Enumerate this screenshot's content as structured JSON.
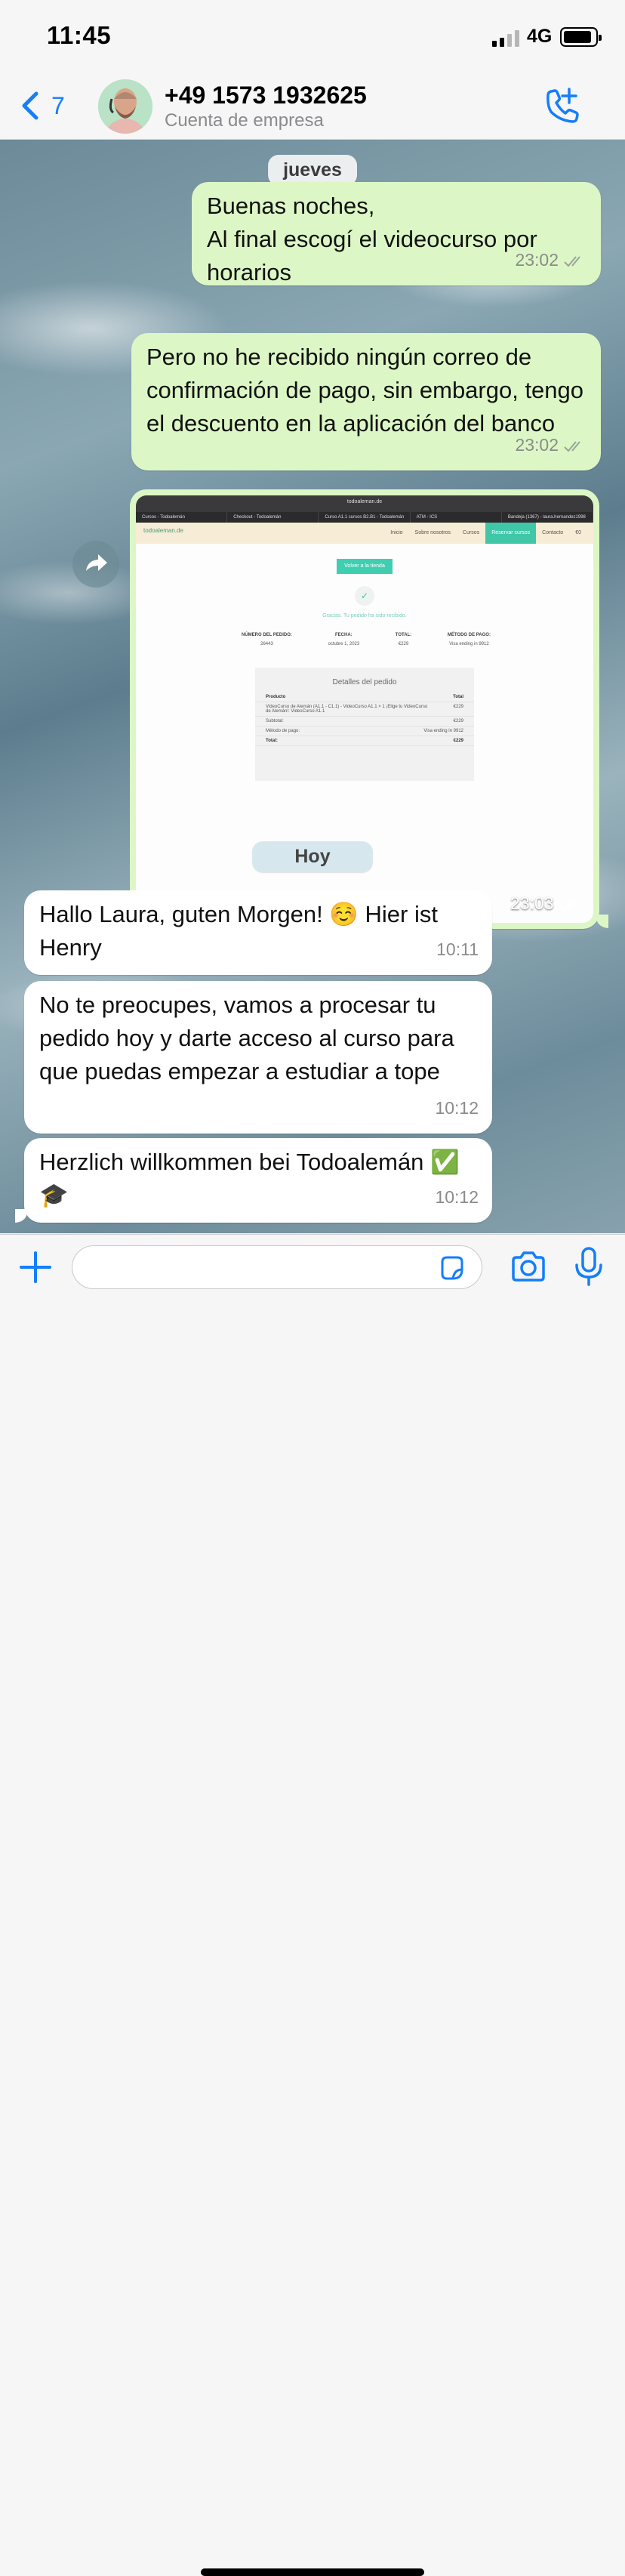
{
  "status_bar": {
    "time": "11:45",
    "network": "4G"
  },
  "header": {
    "back_count": "7",
    "contact_name": "+49 1573 1932625",
    "contact_subtitle": "Cuenta de empresa"
  },
  "chat": {
    "date_separators": {
      "first": "jueves",
      "second": "Hoy"
    },
    "messages": [
      {
        "direction": "out",
        "text": "Buenas noches,\nAl final escogí el videocurso por horarios",
        "time": "23:02",
        "status": "read"
      },
      {
        "direction": "out",
        "text": "Pero no he recibido ningún correo de confirmación de pago, sin embargo, tengo el descuento en la aplicación del banco",
        "time": "23:02",
        "status": "read"
      },
      {
        "direction": "out",
        "type": "image",
        "time": "23:03",
        "status": "read"
      },
      {
        "direction": "in",
        "text": "Hallo Laura, guten Morgen! ☺️ Hier ist Henry",
        "time": "10:11"
      },
      {
        "direction": "in",
        "text": "No te preocupes, vamos a procesar tu pedido hoy y darte acceso al curso para que puedas empezar a estudiar a tope",
        "time": "10:12"
      },
      {
        "direction": "in",
        "text": "Herzlich willkommen bei Todoalemán ✅🎓",
        "time": "10:12"
      }
    ]
  },
  "screenshot": {
    "url": "todoaleman.de",
    "tabs": [
      "Cursos - Todoalemán",
      "Checkout - Todoalemán",
      "Curso A1.1 cursos B2.B1 - Todoalemán",
      "ATM - ICS",
      "Bandeja (1367) - laura.hernandez1998"
    ],
    "logo": "todoaleman.de",
    "nav": [
      "Inicio",
      "Sobre nosotros",
      "Cursos",
      "Reservar cursos",
      "Contacto"
    ],
    "cart": "€0",
    "back_button": "Volver a la tienda",
    "thanks": "Gracias. Tu pedido ha sido recibido.",
    "fields": [
      {
        "label": "NÚMERO DEL PEDIDO:",
        "value": "26443"
      },
      {
        "label": "FECHA:",
        "value": "octubre 1, 2023"
      },
      {
        "label": "TOTAL:",
        "value": "€229"
      },
      {
        "label": "MÉTODO DE PAGO:",
        "value": "Visa ending in 9912"
      }
    ],
    "details_title": "Detalles del pedido",
    "details_rows": [
      {
        "k": "Producto",
        "v": "Total"
      },
      {
        "k": "VideoCurso de Alemán (A1.1 - C1.1) - VideoCurso A1.1 × 1 ¡Elige tu VideoCurso de Alemán!: VideoCurso A1.1",
        "v": "€229"
      },
      {
        "k": "Subtotal:",
        "v": "€229"
      },
      {
        "k": "Método de pago:",
        "v": "Visa ending in 9912"
      },
      {
        "k": "Total:",
        "v": "€229"
      }
    ]
  },
  "colors": {
    "outgoing_bubble": "#dcf7c5",
    "incoming_bubble": "#ffffff",
    "accent": "#147efb"
  },
  "icons": {
    "back": "chevron-left-icon",
    "call": "phone-plus-icon",
    "forward": "forward-arrow-icon",
    "attach": "plus-icon",
    "sticker": "sticker-icon",
    "camera": "camera-icon",
    "mic": "microphone-icon"
  }
}
